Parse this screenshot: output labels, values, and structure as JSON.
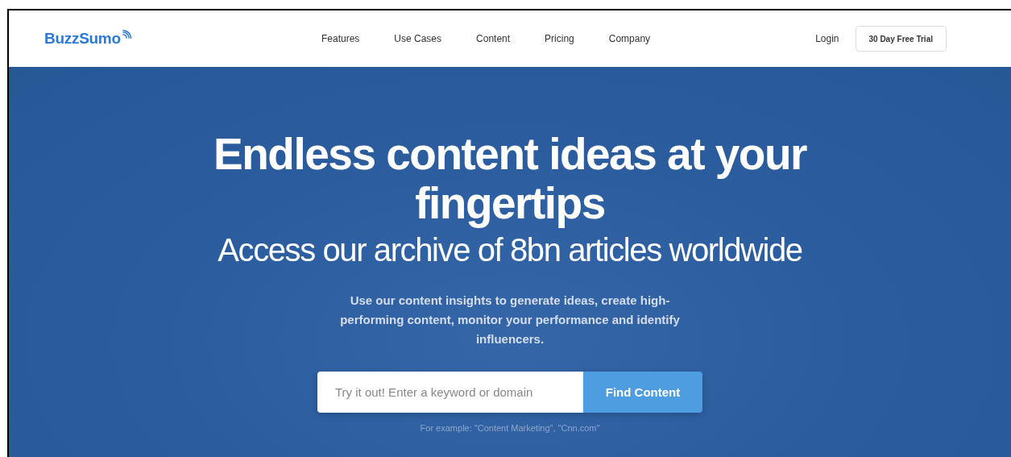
{
  "header": {
    "logo": "BuzzSumo",
    "nav": [
      "Features",
      "Use Cases",
      "Content",
      "Pricing",
      "Company"
    ],
    "login": "Login",
    "trial_button": "30 Day Free Trial"
  },
  "hero": {
    "title": "Endless content ideas at your fingertips",
    "subtitle": "Access our archive of 8bn articles worldwide",
    "description": "Use our content insights to generate ideas, create high-performing content, monitor your performance and identify influencers.",
    "search": {
      "placeholder": "Try it out! Enter a keyword or domain",
      "button": "Find Content"
    },
    "example": "For example: \"Content Marketing\", \"Cnn.com\""
  }
}
